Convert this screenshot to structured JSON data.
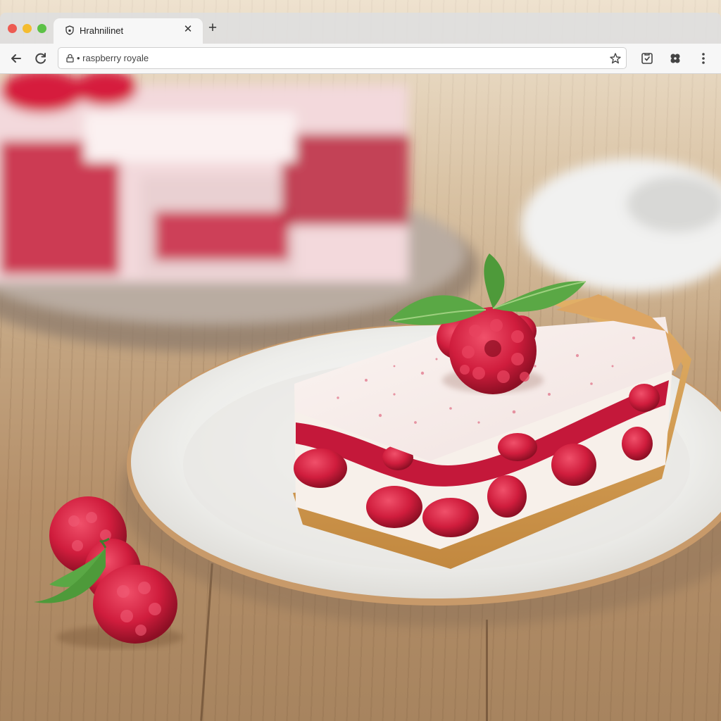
{
  "browser": {
    "tab": {
      "title": "Hrahnilinet",
      "favicon_icon": "shield-icon",
      "close_icon": "close-icon"
    },
    "new_tab_icon": "plus-icon",
    "toolbar": {
      "back_icon": "back-arrow-icon",
      "reload_icon": "reload-icon",
      "address": {
        "lock_icon": "lock-icon",
        "url": "• raspberry royale",
        "bookmark_icon": "star-icon"
      },
      "extensions": [
        "save-icon",
        "extensions-icon",
        "menu-icon"
      ]
    },
    "window_controls": {
      "close_color": "#ed5b52",
      "minimize_color": "#f4bc2f",
      "maximize_color": "#5cc146"
    }
  },
  "photo": {
    "subject": "raspberry-dessert-slice",
    "colors": {
      "raspberry": "#d2223f",
      "cream": "#f6efe9",
      "crust": "#d9a357",
      "plate": "#f2f1ef",
      "plate_rim": "#c89a6a",
      "mint": "#4e9a3a",
      "table": "#b89370"
    }
  }
}
